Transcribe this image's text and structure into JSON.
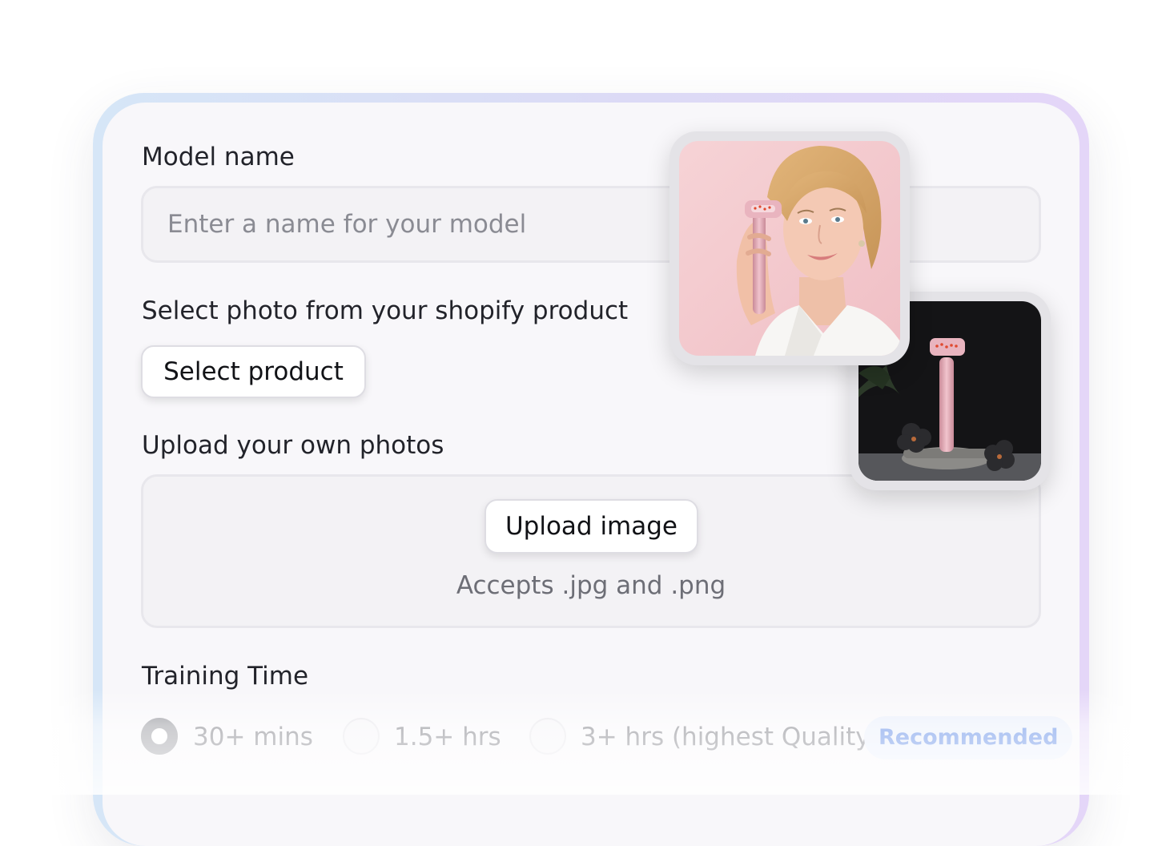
{
  "model_name": {
    "label": "Model name",
    "placeholder": "Enter a name for your model"
  },
  "shopify": {
    "label": "Select photo from your shopify product",
    "button": "Select product"
  },
  "upload": {
    "label": "Upload your own photos",
    "button": "Upload image",
    "hint": "Accepts .jpg and .png"
  },
  "training": {
    "label": "Training Time",
    "options": [
      {
        "label": "30+ mins",
        "selected": true
      },
      {
        "label": "1.5+ hrs",
        "selected": false
      },
      {
        "label": "3+ hrs (highest Quality",
        "selected": false
      }
    ],
    "badge": "Recommended"
  },
  "colors": {
    "accent": "#4a7be3",
    "frame_gradient": [
      "#d6e6f7",
      "#e4d6f8"
    ],
    "product_pink": "#e7a7b4"
  }
}
